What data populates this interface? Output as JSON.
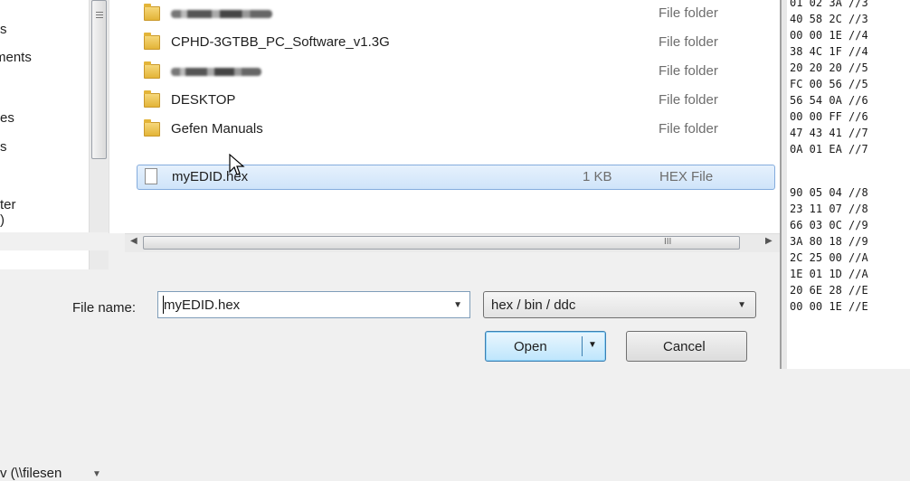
{
  "nav": {
    "items": [
      {
        "label": "s"
      },
      {
        "label": "ments"
      },
      {
        "label": "es"
      },
      {
        "label": "s"
      },
      {
        "label": "ter"
      },
      {
        "label": ")"
      }
    ],
    "location_label": "v (\\\\filesen"
  },
  "files": [
    {
      "name": "",
      "redacted": true,
      "size": "",
      "type": "File folder",
      "icon": "folder-icon"
    },
    {
      "name": "CPHD-3GTBB_PC_Software_v1.3G",
      "redacted": false,
      "size": "",
      "type": "File folder",
      "icon": "folder-icon"
    },
    {
      "name": "",
      "redacted": true,
      "size": "",
      "type": "File folder",
      "icon": "folder-icon"
    },
    {
      "name": "DESKTOP",
      "redacted": false,
      "size": "",
      "type": "File folder",
      "icon": "folder-icon"
    },
    {
      "name": "Gefen Manuals",
      "redacted": false,
      "size": "",
      "type": "File folder",
      "icon": "folder-icon"
    },
    {
      "name": "myEDID.hex",
      "redacted": false,
      "size": "1 KB",
      "type": "HEX File",
      "icon": "file-icon",
      "selected": true
    }
  ],
  "hscroll_grip": "III",
  "form": {
    "file_name_label": "File name:",
    "file_name_value": "myEDID.hex",
    "file_type_value": "hex / bin / ddc",
    "open_label": "Open",
    "cancel_label": "Cancel"
  },
  "hex_lines": [
    "01 02 3A //3",
    "40 58 2C //3",
    "00 00 1E //4",
    "38 4C 1F //4",
    "20 20 20 //5",
    "FC 00 56 //5",
    "56 54 0A //6",
    "00 00 FF //6",
    "47 43 41 //7",
    "0A 01 EA //7",
    "",
    "90 05 04 //8",
    "23 11 07 //8",
    "66 03 0C //9",
    "3A 80 18 //9",
    "2C 25 00 //A",
    "1E 01 1D //A",
    "20 6E 28 //E",
    "00 00 1E //E"
  ],
  "colors": {
    "selection_fill": "#cfe4fa",
    "selection_border": "#84acdd",
    "open_button": "#bee6fd",
    "folder": "#e3b438"
  }
}
